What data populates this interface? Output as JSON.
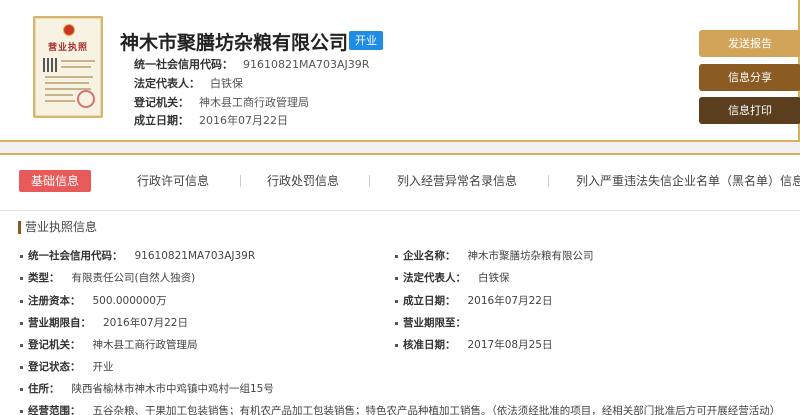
{
  "license_thumb": {
    "title": "营业执照"
  },
  "header": {
    "company_name": "神木市聚膳坊杂粮有限公司",
    "status": "开业",
    "rows": [
      {
        "label": "统一社会信用代码：",
        "value": "91610821MA703AJ39R"
      },
      {
        "label": "法定代表人：",
        "value": "白铁保"
      },
      {
        "label": "登记机关：",
        "value": "神木县工商行政管理局"
      },
      {
        "label": "成立日期：",
        "value": "2016年07月22日"
      }
    ],
    "buttons": {
      "report": "发送报告",
      "share": "信息分享",
      "print": "信息打印"
    }
  },
  "tabs": [
    "基础信息",
    "行政许可信息",
    "行政处罚信息",
    "列入经营异常名录信息",
    "列入严重违法失信企业名单（黑名单）信息"
  ],
  "section": {
    "title": "营业执照信息"
  },
  "fields": {
    "left": [
      {
        "label": "统一社会信用代码：",
        "value": "91610821MA703AJ39R"
      },
      {
        "label": "类型：",
        "value": "有限责任公司(自然人独资)"
      },
      {
        "label": "注册资本：",
        "value": "500.000000万"
      },
      {
        "label": "营业期限自：",
        "value": "2016年07月22日"
      },
      {
        "label": "登记机关：",
        "value": "神木县工商行政管理局"
      },
      {
        "label": "登记状态：",
        "value": "开业"
      }
    ],
    "right": [
      {
        "label": "企业名称：",
        "value": "神木市聚膳坊杂粮有限公司"
      },
      {
        "label": "法定代表人：",
        "value": "白铁保"
      },
      {
        "label": "成立日期：",
        "value": "2016年07月22日"
      },
      {
        "label": "营业期限至：",
        "value": ""
      },
      {
        "label": "核准日期：",
        "value": "2017年08月25日"
      }
    ],
    "address": {
      "label": "住所：",
      "value": "陕西省榆林市神木市中鸡镇中鸡村一组15号"
    },
    "scope": {
      "label": "经营范围：",
      "value": "五谷杂粮、干果加工包装销售；有机农产品加工包装销售；特色农产品种植加工销售。（依法须经批准的项目，经相关部门批准后方可开展经营活动）"
    }
  },
  "colors": {
    "accent": "#d4b25f",
    "status_badge": "#1f8ce6",
    "active_tab": "#e85a5a"
  }
}
